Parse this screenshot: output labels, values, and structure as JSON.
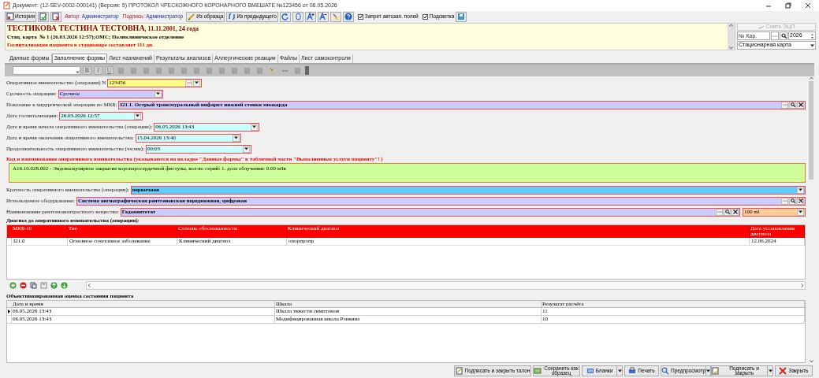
{
  "window": {
    "title": "Документ: (12-SEV-0002-000141) (Версия: 5) ПРОТОКОЛ ЧРЕСКОЖНОГО КОРОНАРНОГО ВМЕШАТЕ №123456 от 06.05.2026"
  },
  "toolbar": {
    "history": "История",
    "author_label": "Автор:",
    "author": "Администратор",
    "signer_label": "Подпись:",
    "signer": "Администратор",
    "from_template": "Из образца",
    "from_previous": "Из предыдущего",
    "checkboxes": [
      {
        "label": "Запрет автозап. полей",
        "checked": true
      },
      {
        "label": "Подсветка",
        "checked": true
      }
    ]
  },
  "patient": {
    "name": "ТЕСТИКОВА ТЕСТИНА ТЕСТОВНА",
    "details": ", 11.11.2001, 24 года",
    "card": "Стац. карта  № 1 (26.03.2026 12:57);ОМС; Поликлиническое отделение",
    "warning": "Госпитализация пациента в стационаре составляет 111 дн."
  },
  "side_panel": {
    "remove_signature": {
      "label": "Снять ЭЦП",
      "disabled": true
    },
    "card_number_placeholder": "№ Кар.",
    "year": "2026",
    "card_type": "Стационарная карта"
  },
  "tabs": [
    {
      "label": "Данные формы",
      "selected": false
    },
    {
      "label": "Заполнение формы",
      "selected": true
    },
    {
      "label": "Лист назначений",
      "selected": false
    },
    {
      "label": "Результаты анализов",
      "selected": false
    },
    {
      "label": "Аллергические реакции",
      "selected": false
    },
    {
      "label": "Файлы",
      "selected": false
    },
    {
      "label": "Лист самоконтроля",
      "selected": false
    }
  ],
  "format_toolbar": {
    "buttons": [
      "B",
      "I",
      "U"
    ]
  },
  "form": {
    "fields_top": [
      {
        "label": "Оперативное вмешательство (операция) N",
        "value": "123456",
        "kind": "number",
        "color": "#ffff88"
      },
      {
        "label": "Срочность операции:",
        "value": "Срочное",
        "kind": "select",
        "color": "#ccccff"
      },
      {
        "label": "Показание к хирургической операции по МКБ:",
        "value": "I21.1. Острый трансмуральный инфаркт нижней стенки миокарда",
        "kind": "lookup",
        "color": "#ccccff"
      },
      {
        "label": "Дата госпитализации:",
        "value": "26.03.2026 12:57",
        "kind": "select",
        "color": "#ccffff"
      },
      {
        "label": "Дата и время начала оперативного вмешательства (операции):",
        "value": "06.05.2026 13:43",
        "kind": "select",
        "color": "#ccffff"
      },
      {
        "label": "Дата и время окончания оперативного вмешательства:",
        "value": "15.04.2026 13:40",
        "kind": "select",
        "color": "#ccffff"
      },
      {
        "label": "Продолжительность оперативного вмешательства (чч:мм):",
        "value": "00:03",
        "kind": "select",
        "color": "#ccffff"
      }
    ],
    "service_note": "Код и наименование оперативного вмешательства (указываются на вкладке \"Данные формы\" в табличной части \"Выполненные услуги пациенту\"! )",
    "service": "A16.10.028.002 - Эндоваскулярное закрытие коронаросердечной фистулы, кол-во серий: 1, доза облучения: 0.00 мЗв",
    "fields_bottom": [
      {
        "label": "Кратность оперативного вмешательства (операции):",
        "value": "первичная",
        "kind": "select",
        "color": "#66ccff"
      },
      {
        "label": "Используемое оборудование:",
        "value": "Система ангиографическая рентгеновская передвижная, цифровая",
        "kind": "lookup",
        "color": "#ccccff"
      },
      {
        "label": "Наименование рентгеноконтрастного вещества:",
        "value": "Гадопентетат",
        "kind": "lookup",
        "color": "#ccccff",
        "amount": {
          "value": "100 ml",
          "color": "#ffcc99"
        }
      }
    ],
    "diagnosis": {
      "title": "Диагноз до оперативного вмешательства (операции):",
      "columns": [
        "МКБ-10",
        "Тип",
        "Степень обоснованности",
        "Клинический диагноз",
        "Дата установления диагноза"
      ],
      "rows": [
        [
          "I21.0",
          "Основное сочетанное заболевание",
          "Клинический диагноз",
          "опорпропр",
          "12.06.2024"
        ]
      ]
    },
    "assessment": {
      "title": "Объективизированная оценка состояния пациента",
      "columns": [
        "Дата и время",
        "Шкала",
        "Результат расчёта"
      ],
      "rows": [
        {
          "cells": [
            "06.05.2026 13:43",
            "Шкала тяжести симптомов",
            "11"
          ],
          "selected": true
        },
        {
          "cells": [
            "06.05.2026 13:43",
            "Модифицированная шкала Рэнкина",
            "10"
          ],
          "selected": false
        }
      ]
    }
  },
  "footer_buttons": [
    {
      "label": "Подписать и закрыть талон",
      "dropdown": false
    },
    {
      "label": "Сохранить как образец",
      "dropdown": false
    },
    {
      "label": "Бланки",
      "dropdown": true
    },
    {
      "label": "Печать",
      "dropdown": false
    },
    {
      "label": "Предпросмотр",
      "dropdown": true
    },
    {
      "label": "Подписать и закрыть",
      "dropdown": true
    },
    {
      "label": "Закрыть",
      "dropdown": false
    }
  ]
}
